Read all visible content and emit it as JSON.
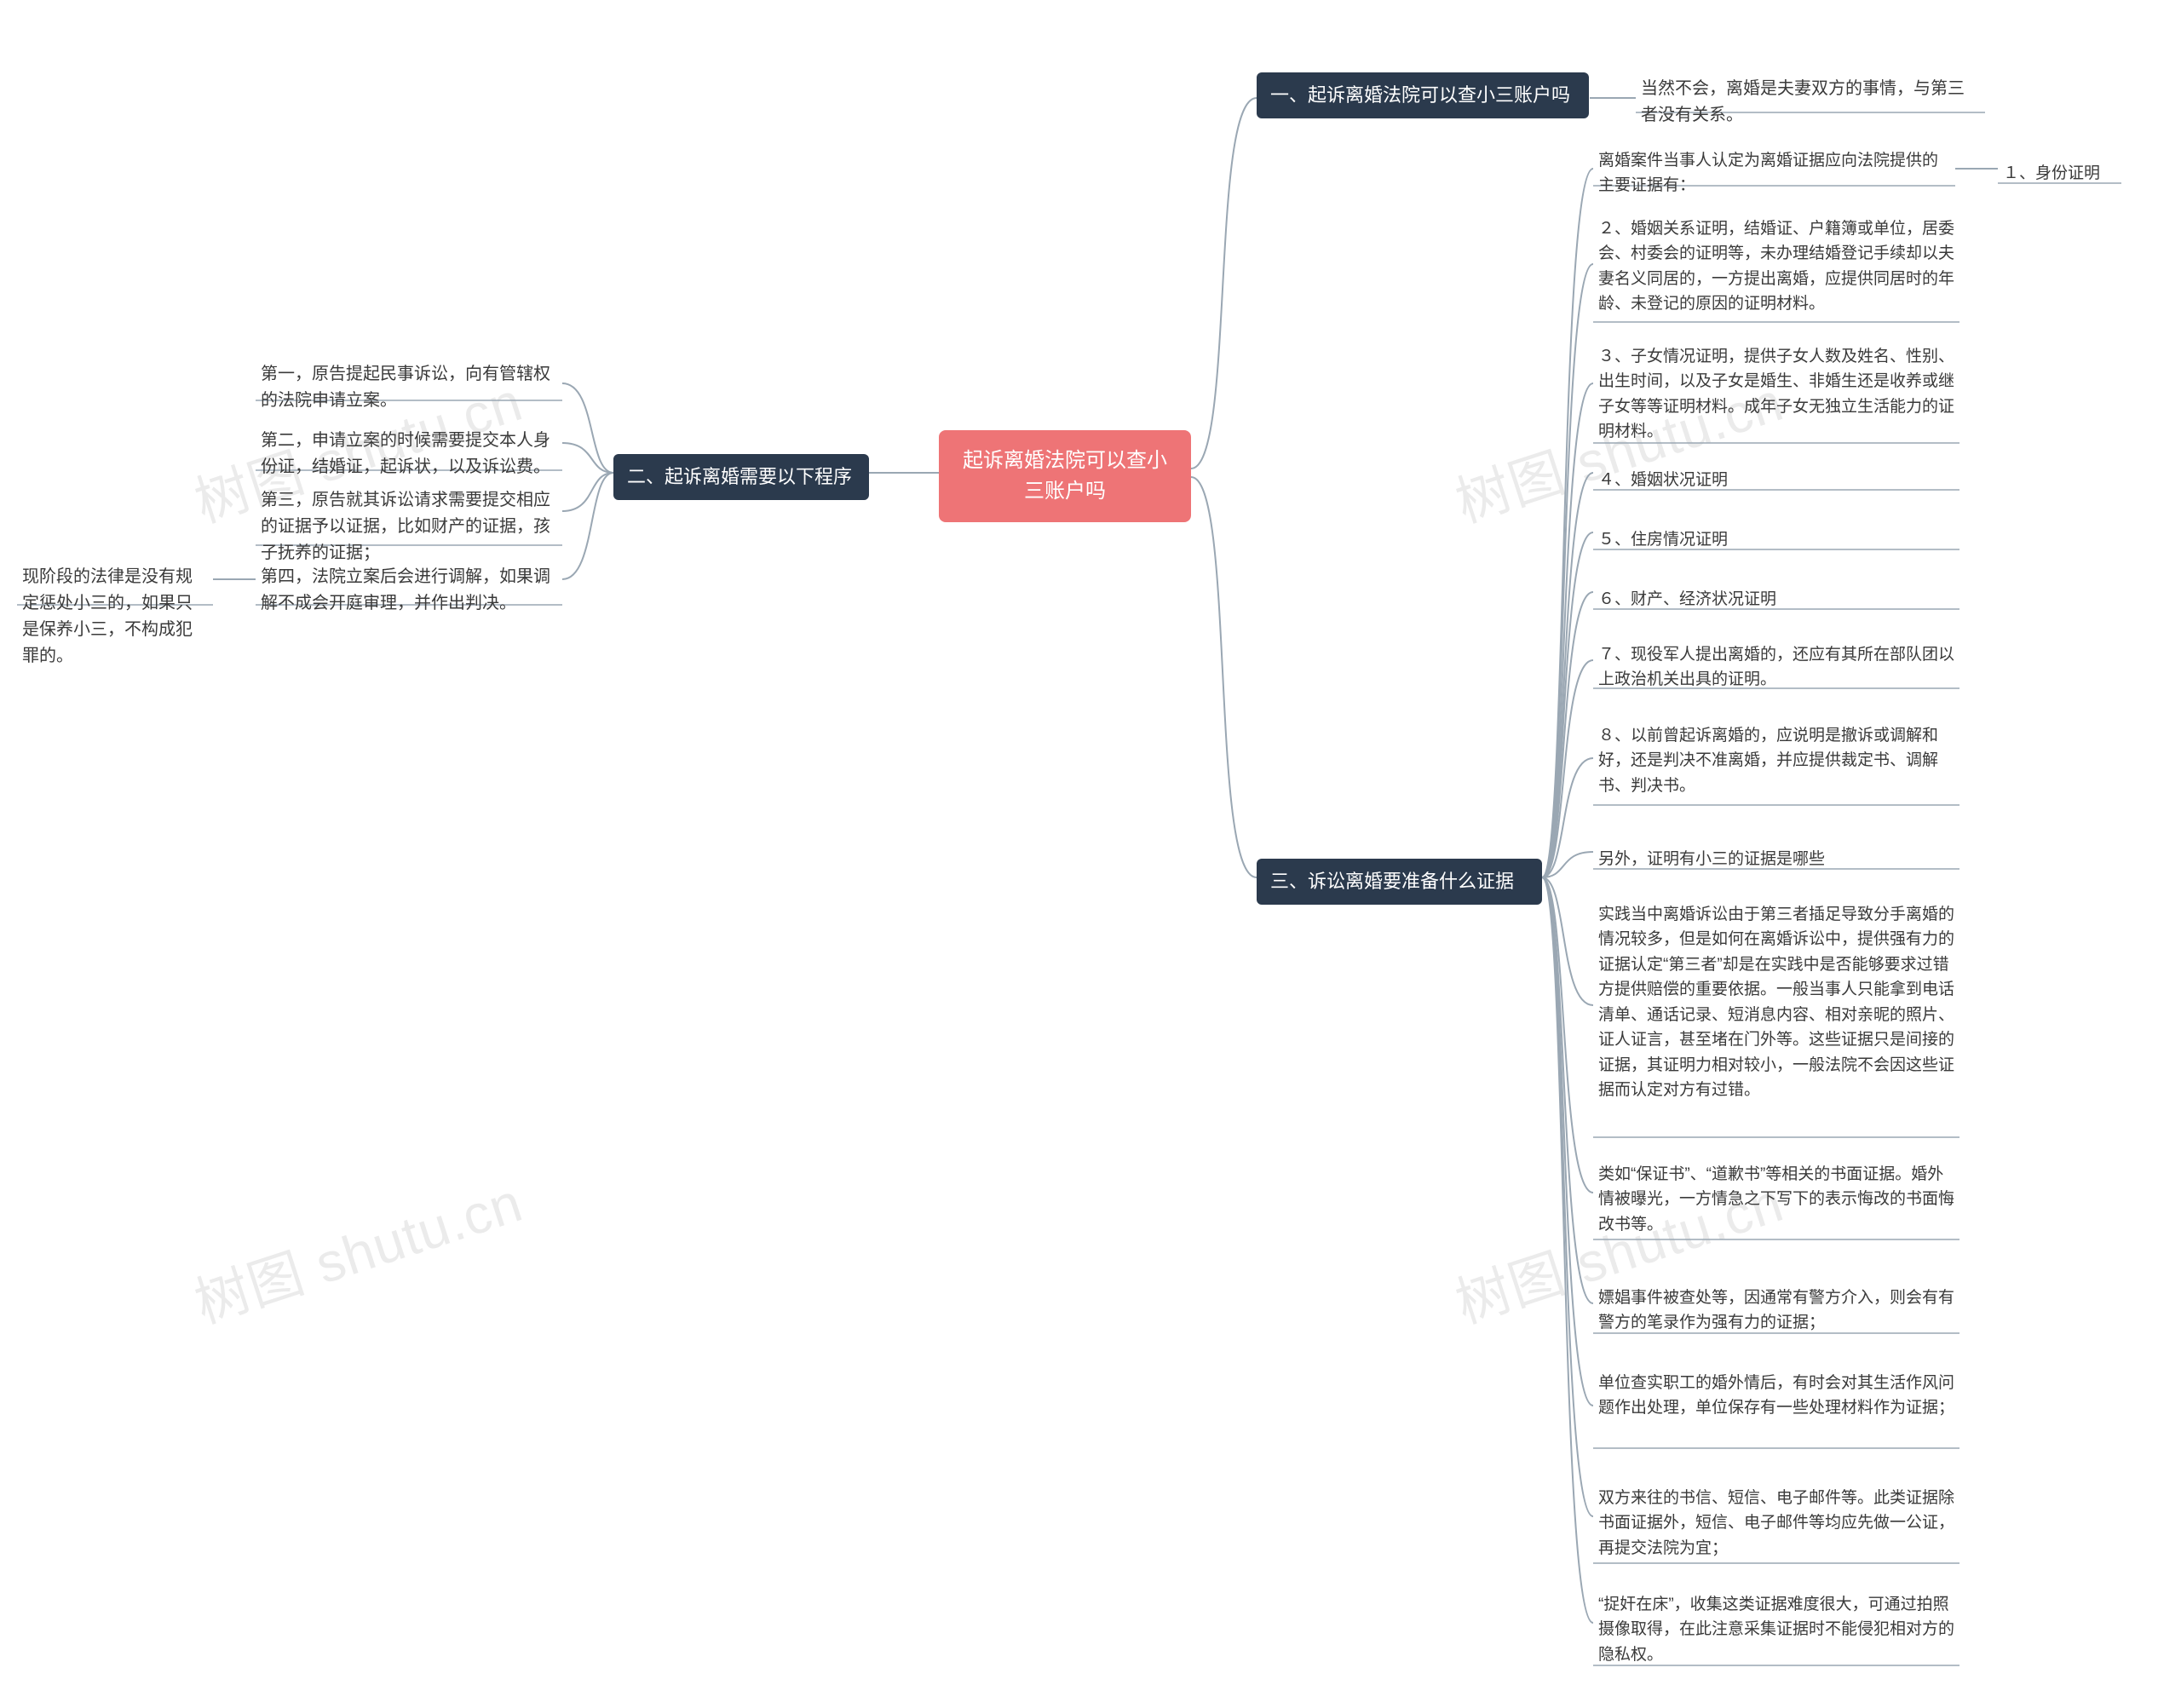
{
  "center": {
    "title": "起诉离婚法院可以查小三账户吗"
  },
  "branch1": {
    "title": "一、起诉离婚法院可以查小三账户吗",
    "leaf": "当然不会，离婚是夫妻双方的事情，与第三者没有关系。"
  },
  "branch2": {
    "title": "二、起诉离婚需要以下程序",
    "leaves": [
      "第一，原告提起民事诉讼，向有管辖权的法院申请立案。",
      "第二，申请立案的时候需要提交本人身份证，结婚证，起诉状，以及诉讼费。",
      "第三，原告就其诉讼请求需要提交相应的证据予以证据，比如财产的证据，孩子抚养的证据；",
      "第四，法院立案后会进行调解，如果调解不成会开庭审理，并作出判决。"
    ],
    "subleaf": "现阶段的法律是没有规定惩处小三的，如果只是保养小三，不构成犯罪的。"
  },
  "branch3": {
    "title": "三、诉讼离婚要准备什么证据",
    "leaves": [
      "离婚案件当事人认定为离婚证据应向法院提供的主要证据有：",
      "２、婚姻关系证明，结婚证、户籍簿或单位，居委会、村委会的证明等，未办理结婚登记手续却以夫妻名义同居的，一方提出离婚，应提供同居时的年龄、未登记的原因的证明材料。",
      "３、子女情况证明，提供子女人数及姓名、性别、出生时间，以及子女是婚生、非婚生还是收养或继子女等等证明材料。成年子女无独立生活能力的证明材料。",
      "４、婚姻状况证明",
      "５、住房情况证明",
      "６、财产、经济状况证明",
      "７、现役军人提出离婚的，还应有其所在部队团以上政治机关出具的证明。",
      "８、以前曾起诉离婚的，应说明是撤诉或调解和好，还是判决不准离婚，并应提供裁定书、调解书、判决书。",
      "另外，证明有小三的证据是哪些",
      "实践当中离婚诉讼由于第三者插足导致分手离婚的情况较多，但是如何在离婚诉讼中，提供强有力的证据认定“第三者”却是在实践中是否能够要求过错方提供赔偿的重要依据。一般当事人只能拿到电话清单、通话记录、短消息内容、相对亲昵的照片、证人证言，甚至堵在门外等。这些证据只是间接的证据，其证明力相对较小，一般法院不会因这些证据而认定对方有过错。",
      "类如“保证书”、“道歉书”等相关的书面证据。婚外情被曝光，一方情急之下写下的表示悔改的书面悔改书等。",
      "嫖娼事件被查处等，因通常有警方介入，则会有有警方的笔录作为强有力的证据；",
      "单位查实职工的婚外情后，有时会对其生活作风问题作出处理，单位保存有一些处理材料作为证据；",
      "双方来往的书信、短信、电子邮件等。此类证据除书面证据外，短信、电子邮件等均应先做一公证，再提交法院为宜；",
      "“捉奸在床”，收集这类证据难度很大，可通过拍照摄像取得，在此注意采集证据时不能侵犯相对方的隐私权。"
    ],
    "leaf0_side": "１、身份证明"
  },
  "watermarks": {
    "text": "树图 shutu.cn"
  }
}
